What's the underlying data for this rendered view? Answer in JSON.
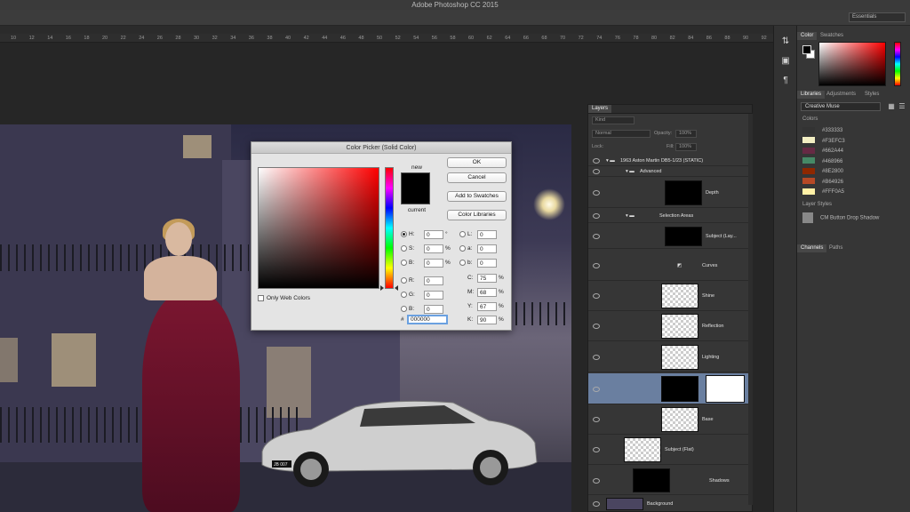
{
  "app": {
    "title": "Adobe Photoshop CC 2015",
    "workspace": "Essentials"
  },
  "ruler": {
    "ticks": [
      "10",
      "12",
      "14",
      "16",
      "18",
      "20",
      "22",
      "24",
      "26",
      "28",
      "30",
      "32",
      "34",
      "36",
      "38",
      "40",
      "42",
      "44",
      "46",
      "48",
      "50",
      "52",
      "54",
      "56",
      "58",
      "60",
      "62",
      "64",
      "66",
      "68",
      "70",
      "72",
      "74",
      "76",
      "78",
      "80",
      "82",
      "84",
      "86",
      "88",
      "90",
      "92"
    ]
  },
  "color_picker": {
    "title": "Color Picker (Solid Color)",
    "new_label": "new",
    "current_label": "current",
    "buttons": {
      "ok": "OK",
      "cancel": "Cancel",
      "add_to_swatches": "Add to Swatches",
      "color_libraries": "Color Libraries"
    },
    "fields": {
      "H": {
        "label": "H:",
        "value": "0",
        "unit": "°"
      },
      "S": {
        "label": "S:",
        "value": "0",
        "unit": "%"
      },
      "B": {
        "label": "B:",
        "value": "0",
        "unit": "%"
      },
      "R": {
        "label": "R:",
        "value": "0"
      },
      "G": {
        "label": "G:",
        "value": "0"
      },
      "Bl": {
        "label": "B:",
        "value": "0"
      },
      "L": {
        "label": "L:",
        "value": "0"
      },
      "a": {
        "label": "a:",
        "value": "0"
      },
      "b": {
        "label": "b:",
        "value": "0"
      },
      "C": {
        "label": "C:",
        "value": "75",
        "unit": "%"
      },
      "M": {
        "label": "M:",
        "value": "68",
        "unit": "%"
      },
      "Y": {
        "label": "Y:",
        "value": "67",
        "unit": "%"
      },
      "K": {
        "label": "K:",
        "value": "90",
        "unit": "%"
      }
    },
    "hex_prefix": "#",
    "hex_value": "000000",
    "only_web_colors": "Only Web Colors",
    "selected_radio": "H"
  },
  "right_panels": {
    "color_tabs": [
      "Color",
      "Swatches"
    ],
    "library_tabs": [
      "Libraries",
      "Adjustments",
      "Styles"
    ],
    "library_name": "Creative Muse",
    "colors_heading": "Colors",
    "library_colors": [
      {
        "hex": "#333333",
        "label": "#333333"
      },
      {
        "hex": "#F3EFC3",
        "label": "#F3EFC3"
      },
      {
        "hex": "#662A44",
        "label": "#662A44"
      },
      {
        "hex": "#468966",
        "label": "#468966"
      },
      {
        "hex": "#8E2800",
        "label": "#8E2800"
      },
      {
        "hex": "#B64926",
        "label": "#B64926"
      },
      {
        "hex": "#FFF0A5",
        "label": "#FFF0A5"
      }
    ],
    "layer_styles_heading": "Layer Styles",
    "layer_style_item": "CM Button Drop Shadow",
    "bottom_tabs": [
      "Channels",
      "Paths"
    ]
  },
  "layers_panel": {
    "tab": "Layers",
    "kind_filter": "Kind",
    "blend_mode": "Normal",
    "opacity_label": "Opacity:",
    "opacity_value": "100%",
    "lock_label": "Lock:",
    "fill_label": "Fill:",
    "fill_value": "100%",
    "layers": [
      {
        "name": "1963 Aston Martin DB5-1/23 (STATIC)",
        "kind": "group"
      },
      {
        "name": "Advanced",
        "kind": "group"
      },
      {
        "name": "Depth",
        "kind": "group-mask"
      },
      {
        "name": "Selection Areas",
        "kind": "group"
      },
      {
        "name": "Subject (Lay...",
        "kind": "group-mask"
      },
      {
        "name": "Curves",
        "kind": "adjustment"
      },
      {
        "name": "Shine",
        "kind": "layer"
      },
      {
        "name": "Reflection",
        "kind": "layer"
      },
      {
        "name": "Lighting",
        "kind": "layer"
      },
      {
        "name": "",
        "kind": "selected"
      },
      {
        "name": "Base",
        "kind": "layer"
      },
      {
        "name": "Subject (Flat)",
        "kind": "layer"
      },
      {
        "name": "Shadows",
        "kind": "layer"
      },
      {
        "name": "Background",
        "kind": "background"
      }
    ]
  },
  "canvas": {
    "plate_text": "JB 007"
  }
}
